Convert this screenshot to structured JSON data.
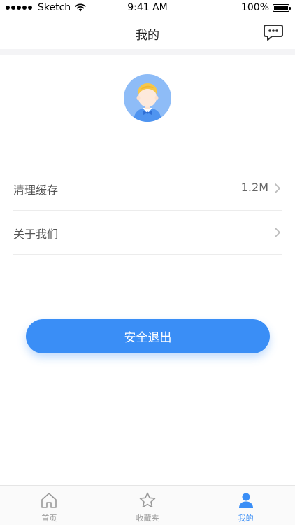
{
  "status_bar": {
    "carrier": "Sketch",
    "time": "9:41 AM",
    "battery": "100%"
  },
  "nav": {
    "title": "我的",
    "message_icon": "chat-bubble-icon"
  },
  "profile": {
    "avatar_icon": "user-avatar-icon"
  },
  "settings": {
    "items": [
      {
        "label": "清理缓存",
        "value": "1.2M"
      },
      {
        "label": "关于我们",
        "value": ""
      }
    ]
  },
  "logout": {
    "label": "安全退出"
  },
  "tabbar": {
    "tabs": [
      {
        "label": "首页",
        "icon": "home-icon",
        "active": false
      },
      {
        "label": "收藏夹",
        "icon": "star-icon",
        "active": false
      },
      {
        "label": "我的",
        "icon": "person-icon",
        "active": true
      }
    ]
  },
  "colors": {
    "accent": "#3a8ef6",
    "text_secondary": "#999999",
    "separator": "#f4f4f6"
  }
}
